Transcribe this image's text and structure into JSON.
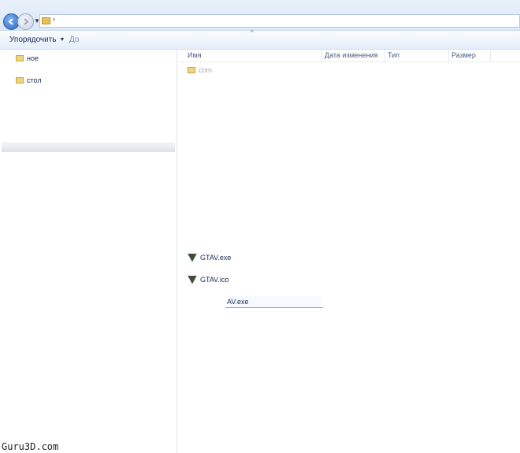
{
  "toolbar": {
    "organize_label": "Упорядочить",
    "next_cmd_label": "До"
  },
  "nav": {
    "items": [
      {
        "label": "ное"
      },
      {
        "label": "стол"
      }
    ]
  },
  "columns": {
    "name": "Имя",
    "date": "Дата изменения",
    "type": "Тип",
    "size": "Размер"
  },
  "files": [
    {
      "name": "com"
    },
    {
      "name": "GTAV.exe"
    },
    {
      "name": "GTAV.ico"
    },
    {
      "name": "AV.exe"
    }
  ],
  "watermark": "Guru3D.com"
}
